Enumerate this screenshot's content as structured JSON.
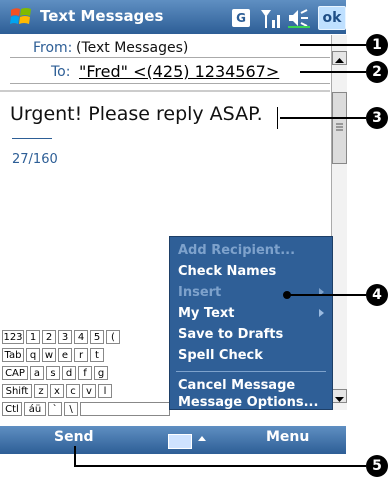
{
  "title_bar": {
    "title": "Text Messages",
    "g_indicator": "G",
    "ok_label": "ok",
    "icons": [
      "windows-start-icon",
      "signal-icon",
      "volume-icon"
    ]
  },
  "header": {
    "from_label": "From:",
    "from_value": "(Text Messages)",
    "to_label": "To:",
    "to_value": "\"Fred\" <(425) 1234567>"
  },
  "message": {
    "body": "Urgent! Please reply ASAP.",
    "char_count": "27/160"
  },
  "keyboard_rows": [
    [
      "123",
      "1",
      "2",
      "3",
      "4",
      "5",
      "("
    ],
    [
      "Tab",
      "q",
      "w",
      "e",
      "r",
      "t"
    ],
    [
      "CAP",
      "a",
      "s",
      "d",
      "f",
      "g"
    ],
    [
      "Shift",
      "z",
      "x",
      "c",
      "v",
      "l"
    ],
    [
      "Ctl",
      "áü",
      "`",
      "\\"
    ]
  ],
  "menu": {
    "items": [
      {
        "label": "Add Recipient...",
        "enabled": false,
        "submenu": false
      },
      {
        "label": "Check Names",
        "enabled": true,
        "submenu": false
      },
      {
        "label": "Insert",
        "enabled": false,
        "submenu": true
      },
      {
        "label": "My Text",
        "enabled": true,
        "submenu": true
      },
      {
        "label": "Save to Drafts",
        "enabled": true,
        "submenu": false
      },
      {
        "label": "Spell Check",
        "enabled": true,
        "submenu": false
      },
      {
        "label": "Cancel Message",
        "enabled": true,
        "submenu": false
      },
      {
        "label": "Message Options...",
        "enabled": true,
        "submenu": false
      }
    ]
  },
  "bottom_bar": {
    "left_soft_key": "Send",
    "right_soft_key": "Menu"
  },
  "callouts": [
    "1",
    "2",
    "3",
    "4",
    "5"
  ],
  "colors": {
    "bar_blue": "#2d5e96",
    "menu_blue": "#2f5f97",
    "disabled_text": "#7ea2cc"
  }
}
